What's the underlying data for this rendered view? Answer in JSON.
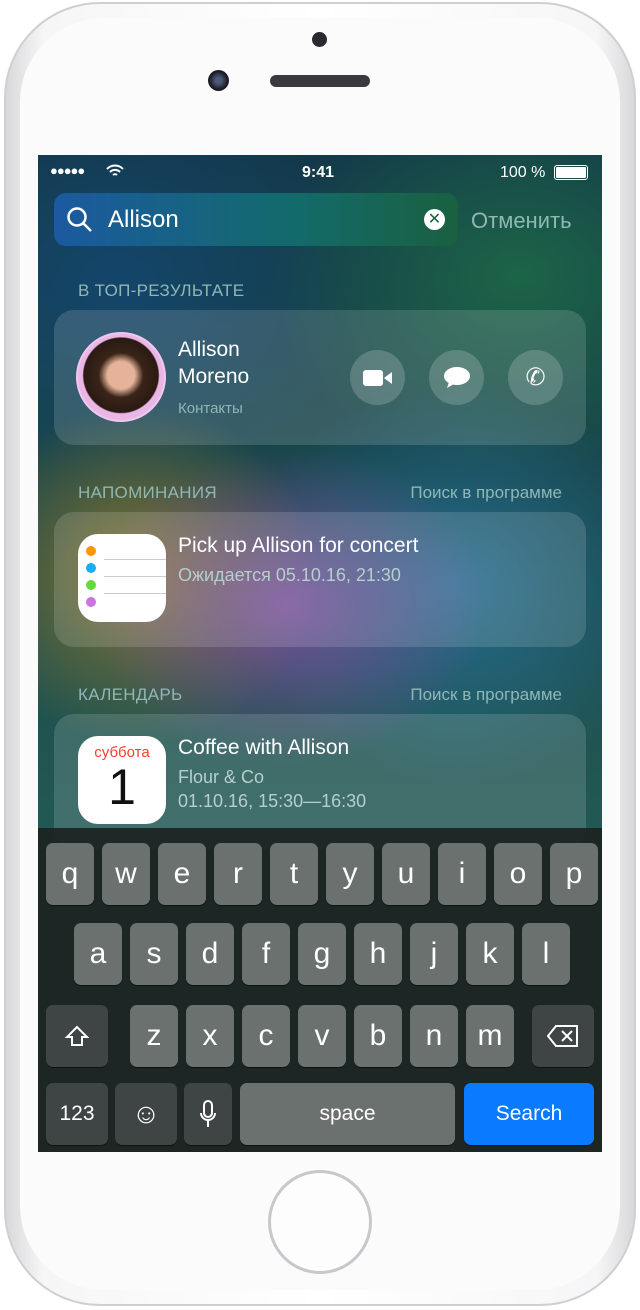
{
  "status": {
    "time": "9:41",
    "battery": "100 %"
  },
  "search": {
    "query": "Allison",
    "cancel": "Отменить"
  },
  "top": {
    "header": "В ТОП-РЕЗУЛЬТАТЕ",
    "first": "Allison",
    "last": "Moreno",
    "source": "Контакты"
  },
  "reminders": {
    "header": "НАПОМИНАНИЯ",
    "action": "Поиск в программе",
    "title": "Pick up Allison for concert",
    "subtitle": "Ожидается 05.10.16, 21:30"
  },
  "calendar": {
    "header": "КАЛЕНДАРЬ",
    "action": "Поиск в программе",
    "day_name": "суббота",
    "day": "1",
    "title": "Coffee with Allison",
    "location": "Flour & Co",
    "time": "01.10.16, 15:30—16:30"
  },
  "keyboard": {
    "row1": [
      "q",
      "w",
      "e",
      "r",
      "t",
      "y",
      "u",
      "i",
      "o",
      "p"
    ],
    "row2": [
      "a",
      "s",
      "d",
      "f",
      "g",
      "h",
      "j",
      "k",
      "l"
    ],
    "row3": [
      "z",
      "x",
      "c",
      "v",
      "b",
      "n",
      "m"
    ],
    "numbers": "123",
    "space": "space",
    "search": "Search"
  },
  "colors": {
    "search_key": "#0a7aff",
    "calendar_red": "#ff3b30"
  }
}
